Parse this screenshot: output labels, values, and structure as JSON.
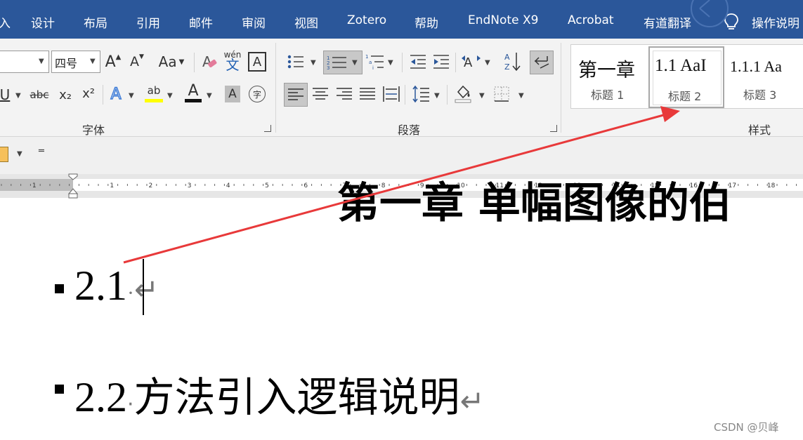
{
  "tabs": [
    "设计",
    "布局",
    "引用",
    "邮件",
    "审阅",
    "视图",
    "Zotero",
    "帮助",
    "EndNote X9",
    "Acrobat",
    "有道翻译"
  ],
  "tell_me": "操作说明",
  "font": {
    "size_value": "四号",
    "grow_label": "A",
    "shrink_label": "A",
    "case_label": "Aa",
    "phonetic_top": "wén",
    "phonetic_bottom": "文",
    "border_char": "A",
    "underline_label": "U",
    "strike_label": "abc",
    "subscript_label": "x₂",
    "superscript_label": "x²",
    "effects_label": "A",
    "highlight_label": "ab",
    "font_color_label": "A",
    "shading_label": "A",
    "enclose_label": "字",
    "group_label": "字体"
  },
  "paragraph": {
    "group_label": "段落"
  },
  "styles": {
    "group_label": "样式",
    "items": [
      {
        "preview": "第一章",
        "name": "标题 1"
      },
      {
        "preview": "1.1  AaI",
        "name": "标题 2"
      },
      {
        "preview": "1.1.1  Aa",
        "name": "标题 3"
      }
    ]
  },
  "ruler": {
    "numbers": [
      "1",
      "1",
      "2",
      "3",
      "4",
      "5",
      "6",
      "7",
      "8",
      "9",
      "10",
      "11",
      "12",
      "13",
      "14",
      "15",
      "16",
      "17",
      "18"
    ]
  },
  "document": {
    "heading_partial": "第一章 单幅图像的伯",
    "h2_1": "2.1",
    "h2_2_number": "2.2",
    "h2_2_text": "方法引入逻辑说明",
    "pilcrow": "↵",
    "space_dot": "·"
  },
  "watermark": "CSDN @贝峰",
  "colors": {
    "tab_bar": "#2b579a",
    "arrow": "#e8393a",
    "highlight_yellow": "#ffff00",
    "font_color_bar": "#c00000"
  }
}
